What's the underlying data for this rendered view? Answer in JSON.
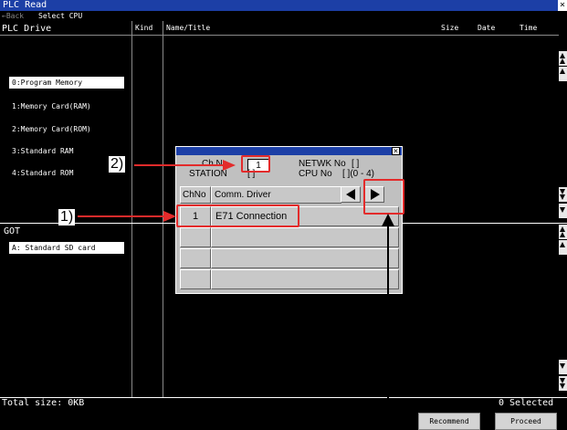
{
  "window": {
    "title": "PLC Read",
    "close_glyph": "×"
  },
  "toolbar": {
    "back_label": "←Back",
    "select_cpu_label": "Select CPU"
  },
  "table_headers": {
    "plc_drive": "PLC Drive",
    "kind": "Kind",
    "name_title": "Name/Title",
    "size": "Size",
    "date": "Date",
    "time": "Time"
  },
  "drives": [
    {
      "label": "0:Program Memory",
      "selected": true
    },
    {
      "label": "1:Memory Card(RAM)",
      "selected": false
    },
    {
      "label": "2:Memory Card(ROM)",
      "selected": false
    },
    {
      "label": "3:Standard RAM",
      "selected": false
    },
    {
      "label": "4:Standard ROM",
      "selected": false
    }
  ],
  "got": {
    "heading": "GOT",
    "drive": "A: Standard SD card"
  },
  "footer": {
    "total_size": "Total size: 0KB",
    "selected_count": "0 Selected",
    "recommend_label": "Recommend",
    "proceed_label": "Proceed"
  },
  "dialog": {
    "close_glyph": "×",
    "ch_no_label": "Ch No",
    "ch_no_value": "1",
    "netwk_no_label": "NETWK No",
    "netwk_no_value": "[   ]",
    "station_label": "STATION",
    "station_value": "[   ]",
    "cpu_no_label": "CPU No",
    "cpu_no_value": "[  ](0 - 4)",
    "col_chno": "ChNo",
    "col_driver": "Comm. Driver",
    "rows": [
      {
        "chno": "1",
        "driver": "E71 Connection"
      },
      {
        "chno": "",
        "driver": ""
      },
      {
        "chno": "",
        "driver": ""
      },
      {
        "chno": "",
        "driver": ""
      }
    ]
  },
  "callouts": {
    "c1": "1)",
    "c2": "2)"
  },
  "colors": {
    "title_bar": "#1c3fa6",
    "annotation_red": "#e32b2b",
    "dialog_gray": "#c0c0c0"
  }
}
